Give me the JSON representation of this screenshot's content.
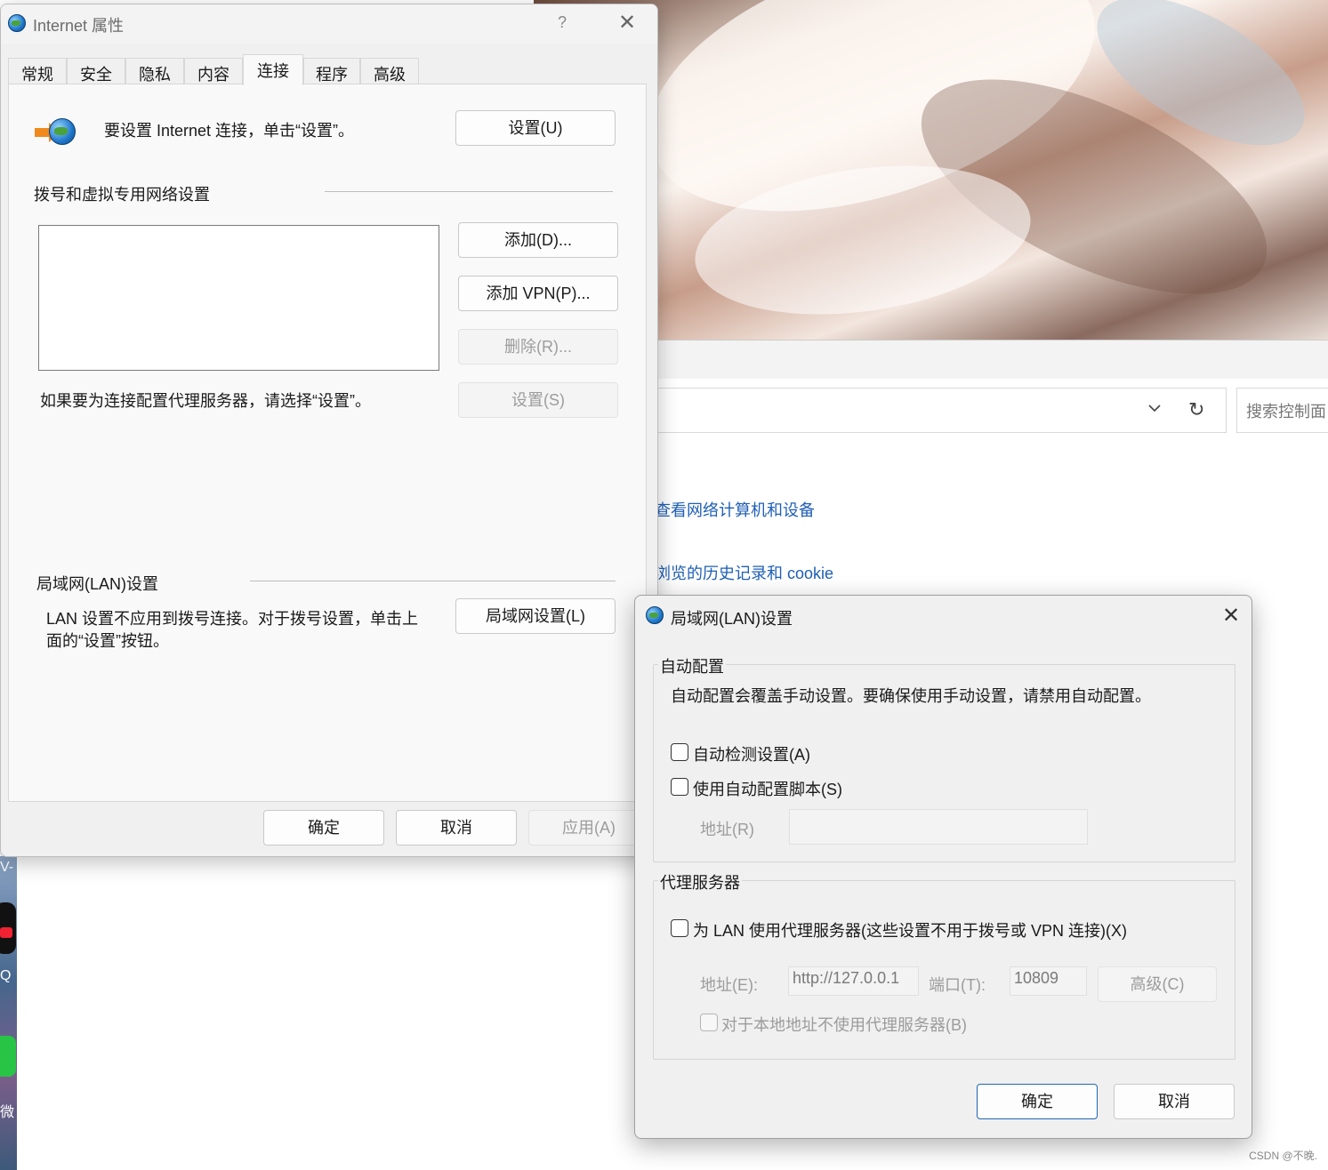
{
  "background": {
    "search_placeholder": "搜索控制面",
    "link_network": "查看网络计算机和设备",
    "link_history": "浏览的历史记录和 cookie",
    "desktop_labels": [
      "V-",
      "Q",
      "微"
    ],
    "watermark": "CSDN @不晚."
  },
  "internet_properties": {
    "title": "Internet 属性",
    "help_label": "?",
    "close_label": "✕",
    "tabs": [
      {
        "label": "常规",
        "active": false
      },
      {
        "label": "安全",
        "active": false
      },
      {
        "label": "隐私",
        "active": false
      },
      {
        "label": "内容",
        "active": false
      },
      {
        "label": "连接",
        "active": true
      },
      {
        "label": "程序",
        "active": false
      },
      {
        "label": "高级",
        "active": false
      }
    ],
    "setup_text": "要设置 Internet 连接，单击“设置”。",
    "setup_button": "设置(U)",
    "dialup_section_label": "拨号和虚拟专用网络设置",
    "add_button": "添加(D)...",
    "add_vpn_button": "添加 VPN(P)...",
    "remove_button": "删除(R)...",
    "proxy_hint": "如果要为连接配置代理服务器，请选择“设置”。",
    "settings_button": "设置(S)",
    "lan_section_label": "局域网(LAN)设置",
    "lan_text_line1": "LAN 设置不应用到拨号连接。对于拨号设置，单击上",
    "lan_text_line2": "面的“设置”按钮。",
    "lan_settings_button": "局域网设置(L)",
    "ok_button": "确定",
    "cancel_button": "取消",
    "apply_button": "应用(A)"
  },
  "lan_dialog": {
    "title": "局域网(LAN)设置",
    "close_label": "✕",
    "auto_config": {
      "group_label": "自动配置",
      "description": "自动配置会覆盖手动设置。要确保使用手动设置，请禁用自动配置。",
      "auto_detect_label": "自动检测设置(A)",
      "auto_detect_checked": false,
      "use_script_label": "使用自动配置脚本(S)",
      "use_script_checked": false,
      "address_label": "地址(R)",
      "address_value": ""
    },
    "proxy": {
      "group_label": "代理服务器",
      "use_proxy_label": "为 LAN 使用代理服务器(这些设置不用于拨号或 VPN 连接)(X)",
      "use_proxy_checked": false,
      "address_label": "地址(E):",
      "address_value": "http://127.0.0.1",
      "port_label": "端口(T):",
      "port_value": "10809",
      "advanced_button": "高级(C)",
      "bypass_local_label": "对于本地地址不使用代理服务器(B)",
      "bypass_local_checked": false
    },
    "ok_button": "确定",
    "cancel_button": "取消"
  }
}
